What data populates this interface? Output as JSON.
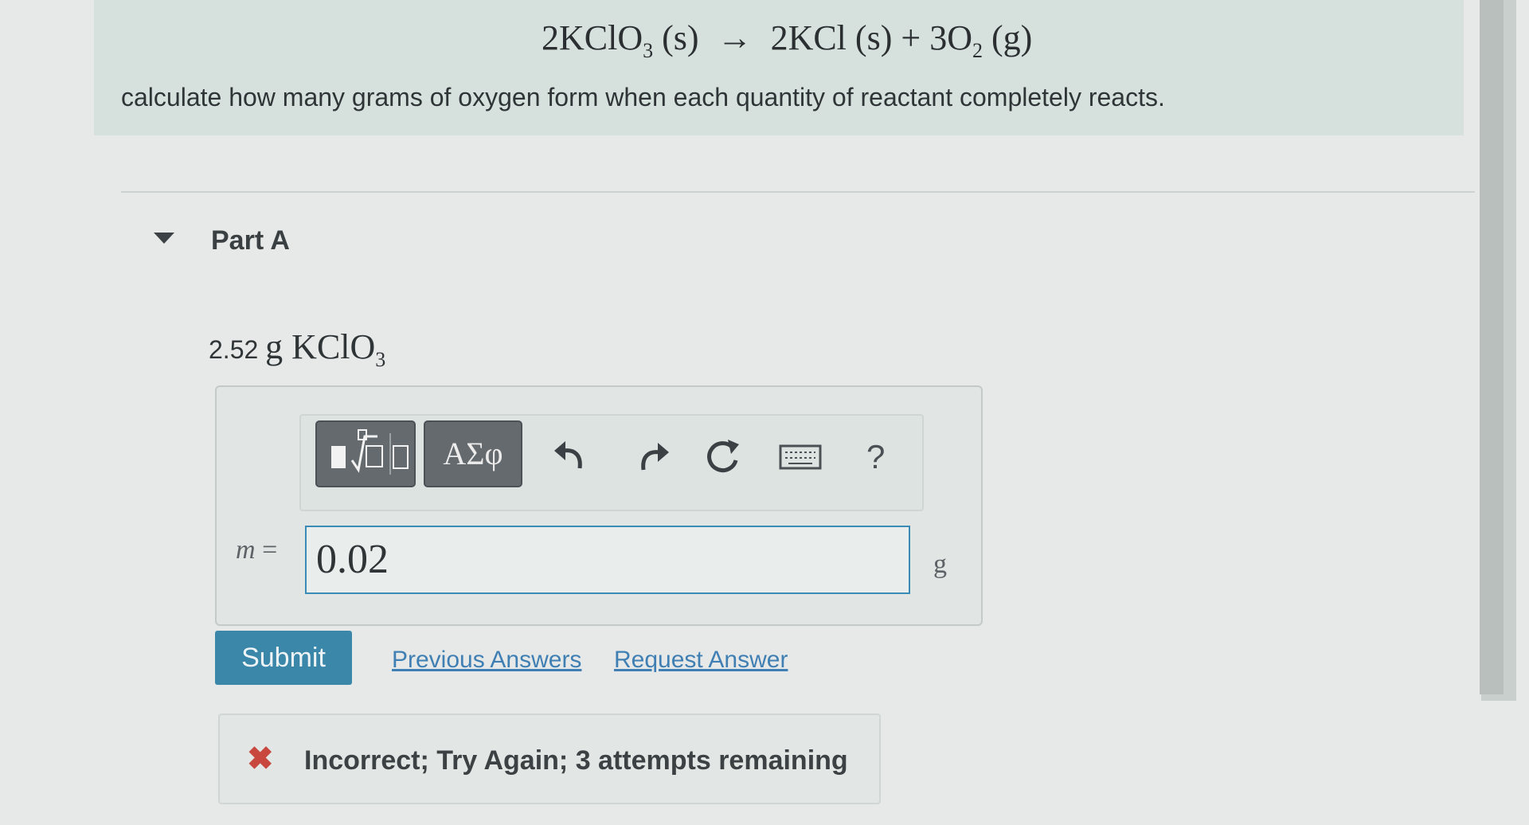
{
  "header": {
    "equation": {
      "reactant_coef": "2",
      "reactant_formula": "KClO",
      "reactant_sub": "3",
      "reactant_state": "(s)",
      "arrow": "→",
      "product1_coef": "2",
      "product1_formula": "KCl",
      "product1_state": "(s)",
      "plus": "+",
      "product2_coef": "3",
      "product2_formula": "O",
      "product2_sub": "2",
      "product2_state": "(g)"
    },
    "instructions": "calculate how many grams of oxygen form when each quantity of reactant completely reacts."
  },
  "part": {
    "title": "Part A",
    "quantity_value": "2.52",
    "quantity_unit": "g",
    "quantity_formula": "KClO",
    "quantity_sub": "3"
  },
  "toolbar": {
    "templates_icon": "templates-sqrt-icon",
    "greek_label": "ΑΣφ",
    "undo_icon": "undo-icon",
    "redo_icon": "redo-icon",
    "reset_icon": "reset-icon",
    "keyboard_icon": "keyboard-icon",
    "help_label": "?"
  },
  "answer": {
    "variable": "m",
    "equals": "=",
    "value": "0.02",
    "unit": "g"
  },
  "actions": {
    "submit_label": "Submit",
    "previous_answers_label": "Previous Answers",
    "request_answer_label": "Request Answer"
  },
  "feedback": {
    "icon": "x-icon",
    "message": "Incorrect; Try Again; 3 attempts remaining"
  },
  "colors": {
    "submit": "#3b87a9",
    "link": "#3f7fb3",
    "incorrect": "#c8473f",
    "input_border": "#3a8bb6"
  }
}
